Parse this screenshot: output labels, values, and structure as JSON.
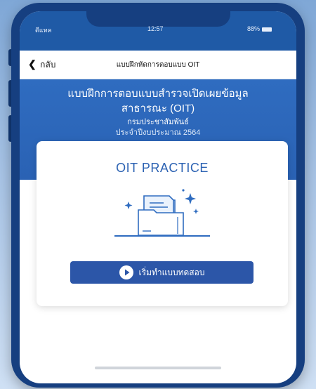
{
  "status_bar": {
    "carrier": "ดีแทค",
    "time": "12:57",
    "battery": "88%"
  },
  "nav": {
    "back_label": "กลับ",
    "title": "แบบฝึกหัดการตอบแบบ OIT"
  },
  "banner": {
    "line1": "แบบฝึกการตอบแบบสำรวจเปิดเผยข้อมูล",
    "line2": "สาธารณะ (OIT)",
    "line3": "กรมประชาสัมพันธ์",
    "line4": "ประจำปีงบประมาณ 2564"
  },
  "card": {
    "title": "OIT PRACTICE",
    "illustration_icon": "folder-documents-icon",
    "start_button_label": "เริ่มทำแบบทดสอบ",
    "start_button_icon": "play-icon"
  },
  "colors": {
    "primary": "#2c56a8",
    "banner": "#2f6cc0",
    "title": "#2d63b3"
  }
}
